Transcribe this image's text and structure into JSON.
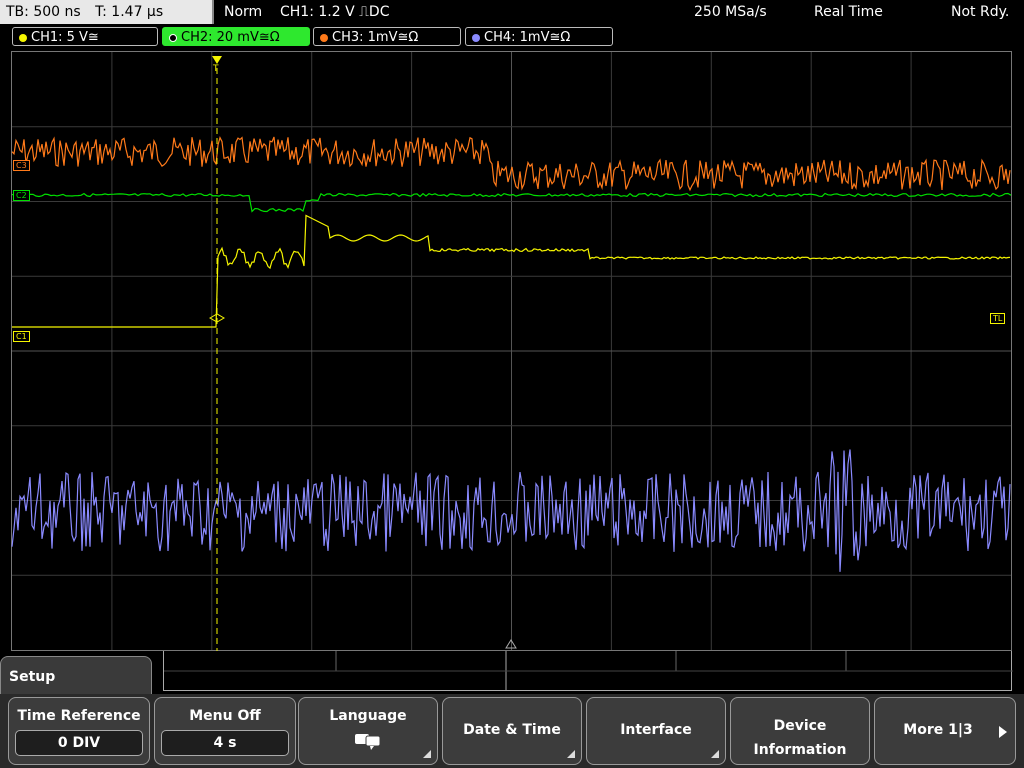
{
  "topbar": {
    "tb": "TB: 500 ns",
    "t": "T: 1.47 µs",
    "mode": "Norm",
    "trigger": "CH1: 1.2 V ⎍DC",
    "sample_rate": "250 MSa/s",
    "acq_mode": "Real Time",
    "status": "Not Rdy."
  },
  "channels": [
    {
      "label": "CH1: 5 V≅",
      "color": "#f5f500",
      "active": false
    },
    {
      "label": "CH2: 20 mV≅Ω",
      "color": "#00e000",
      "active": true
    },
    {
      "label": "CH3: 1mV≅Ω",
      "color": "#ff7a1a",
      "active": false
    },
    {
      "label": "CH4: 1mV≅Ω",
      "color": "#8a8aff",
      "active": false
    }
  ],
  "markers": {
    "c1": "C1",
    "c2": "C2",
    "c3": "C3",
    "tl": "TL",
    "trigger_pos": "T"
  },
  "menu": {
    "title": "Setup"
  },
  "softkeys": {
    "time_reference": {
      "label": "Time Reference",
      "value": "0 DIV"
    },
    "menu_off": {
      "label": "Menu Off",
      "value": "4 s"
    },
    "language": {
      "label": "Language"
    },
    "date_time": {
      "label": "Date & Time"
    },
    "interface": {
      "label": "Interface"
    },
    "device_information": {
      "label1": "Device",
      "label2": "Information"
    },
    "more": {
      "label": "More 1|3"
    }
  }
}
